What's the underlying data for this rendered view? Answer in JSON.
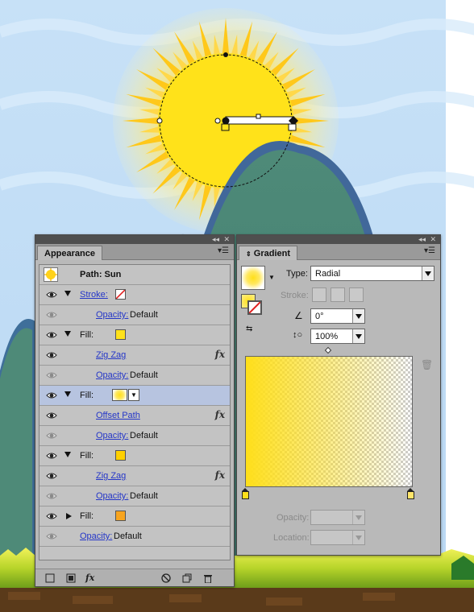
{
  "appearance": {
    "tab_label": "Appearance",
    "path_label": "Path: Sun",
    "rows": [
      {
        "type": "stroke",
        "label": "Stroke:"
      },
      {
        "type": "opacity",
        "label": "Opacity:",
        "value": "Default"
      },
      {
        "type": "fill",
        "label": "Fill:",
        "swatch_color": "#ffe21a"
      },
      {
        "type": "effect",
        "label": "Zig Zag"
      },
      {
        "type": "opacity",
        "label": "Opacity:",
        "value": "Default"
      },
      {
        "type": "fill",
        "label": "Fill:",
        "selected": true
      },
      {
        "type": "effect",
        "label": "Offset Path"
      },
      {
        "type": "opacity",
        "label": "Opacity:",
        "value": "Default"
      },
      {
        "type": "fill",
        "label": "Fill:",
        "swatch_color": "#ffd000"
      },
      {
        "type": "effect",
        "label": "Zig Zag"
      },
      {
        "type": "opacity",
        "label": "Opacity:",
        "value": "Default"
      },
      {
        "type": "fill",
        "label": "Fill:",
        "swatch_color": "#f7a41e"
      },
      {
        "type": "opacity",
        "label": "Opacity:",
        "value": "Default"
      }
    ],
    "fx_symbol": "fx",
    "bottom_icons": [
      "new-stroke-icon",
      "new-fill-icon",
      "add-effect-icon",
      "clear-icon",
      "duplicate-icon",
      "delete-icon"
    ]
  },
  "gradient": {
    "tab_label": "Gradient",
    "type_label": "Type:",
    "type_value": "Radial",
    "stroke_label": "Stroke:",
    "angle_value": "0°",
    "aspect_value": "100%",
    "start_color": "#ffdf1a",
    "end_color": "transparent",
    "opacity_label": "Opacity:",
    "location_label": "Location:"
  }
}
